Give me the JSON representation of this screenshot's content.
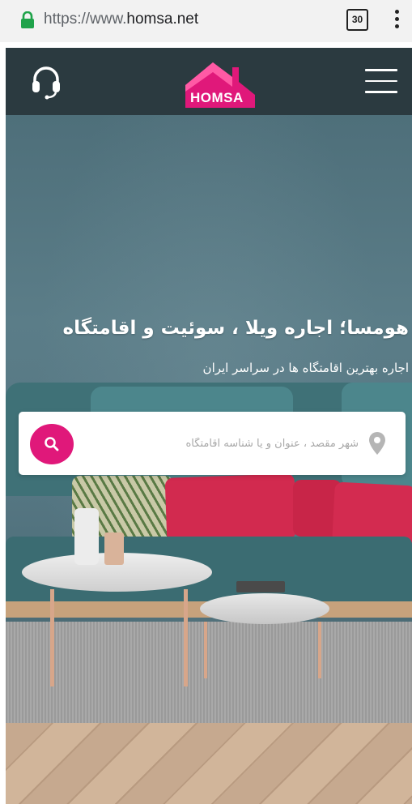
{
  "browser": {
    "url_prefix": "https://www.",
    "url_domain": "homsa.net",
    "tab_count": "30"
  },
  "header": {
    "logo_text": "HOMSA",
    "colors": {
      "background": "#2b3a40",
      "brand": "#e0187a"
    },
    "icons": [
      "headset-icon",
      "homsa-logo",
      "hamburger-menu-icon"
    ]
  },
  "hero": {
    "title": "هومسا؛ اجاره ویلا ، سوئیت و اقامتگاه",
    "subtitle": "اجاره بهترین اقامتگاه ها در سراسر ایران"
  },
  "search": {
    "placeholder": "شهر مقصد ، عنوان و یا شناسه اقامتگاه",
    "value": ""
  }
}
